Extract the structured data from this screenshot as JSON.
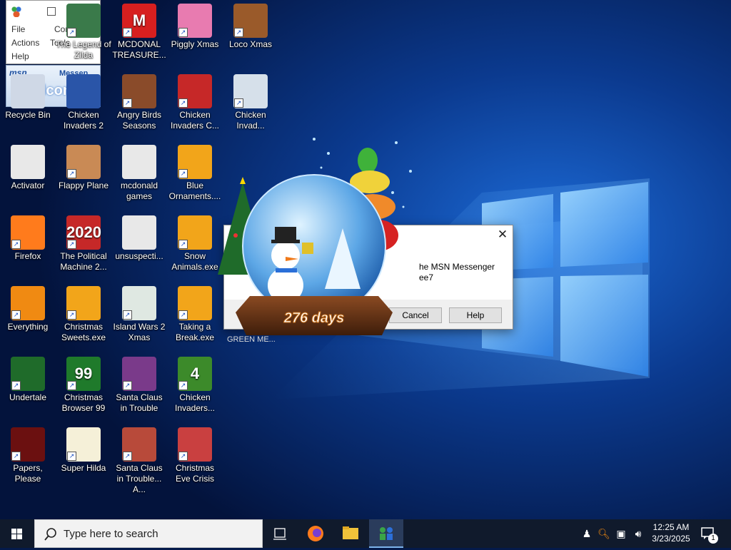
{
  "msn_window": {
    "menu": [
      "File",
      "Contacts",
      "Actions",
      "Tools",
      "Help"
    ],
    "banner_logo": "msn",
    "banner_brand": "Messen...",
    "banner_text": "welcome"
  },
  "desktop_icons": [
    {
      "label": "Recycle Bin",
      "icon": "recycle-bin-icon",
      "color": "#cfd8e6",
      "shortcut": false,
      "sym": ""
    },
    {
      "label": "Activator",
      "icon": "file-icon",
      "color": "#e8e8e8",
      "shortcut": false,
      "sym": ""
    },
    {
      "label": "Firefox",
      "icon": "firefox-icon",
      "color": "#ff7b1c",
      "shortcut": true,
      "sym": ""
    },
    {
      "label": "Everything",
      "icon": "magnifier-icon",
      "color": "#f08a12",
      "shortcut": true,
      "sym": ""
    },
    {
      "label": "Undertale",
      "icon": "undertale-icon",
      "color": "#1f6b2a",
      "shortcut": true,
      "sym": ""
    },
    {
      "label": "Papers, Please",
      "icon": "papers-please-icon",
      "color": "#6b1010",
      "shortcut": true,
      "sym": ""
    },
    {
      "label": "The Legend of Zilda",
      "icon": "zilda-icon",
      "color": "#3a7a4a",
      "shortcut": true,
      "sym": ""
    },
    {
      "label": "Chicken Invaders 2",
      "icon": "chicken-icon",
      "color": "#2a55a8",
      "shortcut": false,
      "sym": ""
    },
    {
      "label": "Flappy Plane",
      "icon": "plane-icon",
      "color": "#c98a55",
      "shortcut": true,
      "sym": ""
    },
    {
      "label": "The Political Machine 2...",
      "icon": "political-icon",
      "color": "#c62828",
      "shortcut": true,
      "sym": "2020"
    },
    {
      "label": "Christmas Sweets.exe",
      "icon": "puzzle-icon",
      "color": "#f2a51a",
      "shortcut": true,
      "sym": ""
    },
    {
      "label": "Christmas Browser 99",
      "icon": "xmas-tree-icon",
      "color": "#1f7a2b",
      "shortcut": true,
      "sym": "99"
    },
    {
      "label": "Super Hilda",
      "icon": "hilda-icon",
      "color": "#f5f0d8",
      "shortcut": true,
      "sym": ""
    },
    {
      "label": "MCDONAL TREASURE...",
      "icon": "mcdonalds-icon",
      "color": "#d71f1f",
      "shortcut": true,
      "sym": "M"
    },
    {
      "label": "Angry Birds Seasons",
      "icon": "angry-birds-icon",
      "color": "#8a4b2a",
      "shortcut": true,
      "sym": ""
    },
    {
      "label": "mcdonald games",
      "icon": "file-icon",
      "color": "#e8e8e8",
      "shortcut": false,
      "sym": ""
    },
    {
      "label": "unsuspecti...",
      "icon": "file-icon",
      "color": "#e8e8e8",
      "shortcut": false,
      "sym": ""
    },
    {
      "label": "Island Wars 2 Xmas",
      "icon": "island-icon",
      "color": "#dfe8e2",
      "shortcut": true,
      "sym": ""
    },
    {
      "label": "Santa Claus in Trouble",
      "icon": "santa-icon",
      "color": "#7a3a8a",
      "shortcut": true,
      "sym": ""
    },
    {
      "label": "Santa Claus in Trouble... A...",
      "icon": "santa-icon",
      "color": "#b84a3a",
      "shortcut": true,
      "sym": ""
    },
    {
      "label": "Piggly Xmas",
      "icon": "pig-icon",
      "color": "#e87bb0",
      "shortcut": true,
      "sym": ""
    },
    {
      "label": "Chicken Invaders C...",
      "icon": "chicken-icon",
      "color": "#c62828",
      "shortcut": true,
      "sym": ""
    },
    {
      "label": "Blue Ornaments....",
      "icon": "puzzle-icon",
      "color": "#f2a51a",
      "shortcut": true,
      "sym": ""
    },
    {
      "label": "Snow Animals.exe",
      "icon": "puzzle-icon",
      "color": "#f2a51a",
      "shortcut": true,
      "sym": ""
    },
    {
      "label": "Taking a Break.exe",
      "icon": "puzzle-icon",
      "color": "#f2a51a",
      "shortcut": true,
      "sym": ""
    },
    {
      "label": "Chicken Invaders...",
      "icon": "chicken-icon",
      "color": "#3c8a2a",
      "shortcut": true,
      "sym": "4"
    },
    {
      "label": "Christmas Eve Crisis",
      "icon": "santa-icon",
      "color": "#c94040",
      "shortcut": true,
      "sym": ""
    },
    {
      "label": "Loco Xmas",
      "icon": "bear-icon",
      "color": "#9a5a2a",
      "shortcut": true,
      "sym": ""
    },
    {
      "label": "Chicken Invad...",
      "icon": "chicken-icon",
      "color": "#d6e0ea",
      "shortcut": true,
      "sym": ""
    }
  ],
  "dialog": {
    "message_line1": "he MSN Messenger",
    "message_line2": "ee7",
    "cancel_label": "Cancel",
    "help_label": "Help",
    "close_glyph": "✕",
    "green_label": "GREEN ME..."
  },
  "widget": {
    "days_label": "276 days"
  },
  "taskbar": {
    "search_placeholder": "Type here to search",
    "time": "12:25 AM",
    "date": "3/23/2025",
    "notification_count": "1"
  }
}
